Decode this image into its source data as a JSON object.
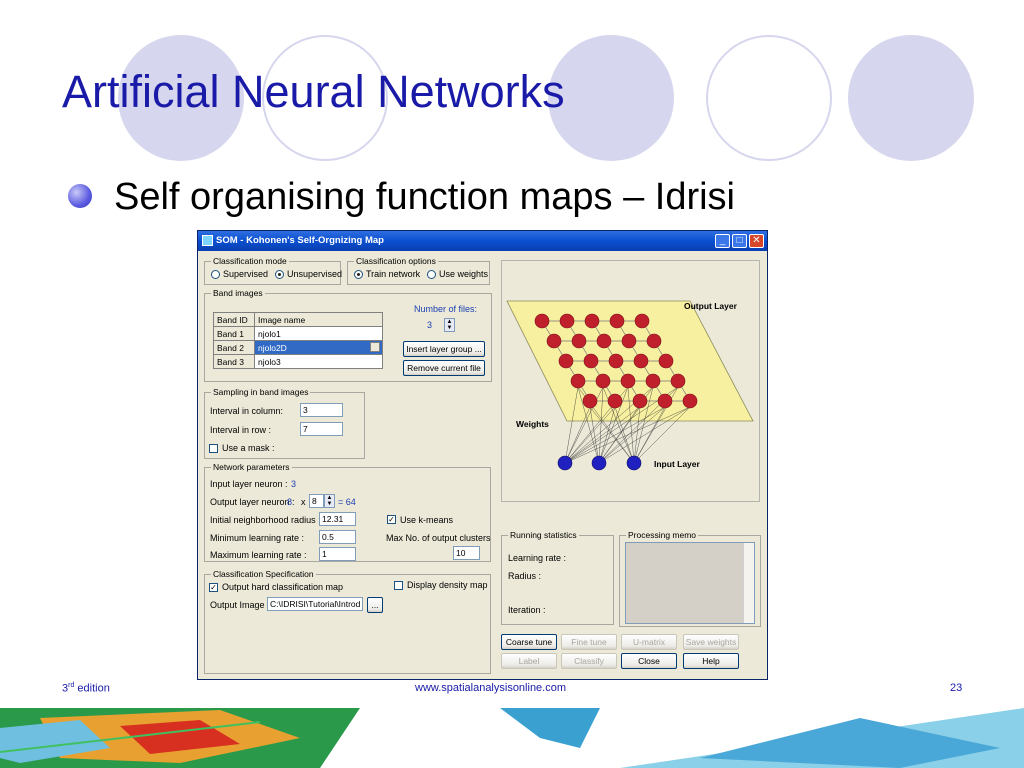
{
  "slide": {
    "title": "Artificial Neural Networks",
    "bullet": "Self organising function maps – Idrisi"
  },
  "window": {
    "title": "SOM - Kohonen's Self-Orgnizing Map",
    "classification_mode": {
      "label": "Classification mode",
      "options": [
        "Supervised",
        "Unsupervised"
      ],
      "selected": "Unsupervised"
    },
    "classification_options": {
      "label": "Classification options",
      "options": [
        "Train network",
        "Use weights"
      ],
      "selected": "Train network"
    },
    "band_images": {
      "label": "Band images",
      "headers": [
        "Band ID",
        "Image name"
      ],
      "rows": [
        {
          "id": "Band 1",
          "name": "njolo1"
        },
        {
          "id": "Band 2",
          "name": "njolo2D"
        },
        {
          "id": "Band 3",
          "name": "njolo3"
        }
      ],
      "selected_row": "Band 2",
      "number_of_files_label": "Number of files:",
      "number_of_files": "3",
      "insert_button": "Insert layer group ...",
      "remove_button": "Remove current file"
    },
    "sampling": {
      "label": "Sampling in band images",
      "interval_column_label": "Interval in column:",
      "interval_column": "3",
      "interval_row_label": "Interval in row :",
      "interval_row": "7",
      "use_mask_label": "Use a mask :",
      "use_mask": false
    },
    "network": {
      "label": "Network parameters",
      "input_neuron_label": "Input layer neuron :",
      "input_neuron": "3",
      "output_neuron_label": "Output layer neuron :",
      "output_a": "8",
      "times": "x",
      "output_b": "8",
      "equals": "= 64",
      "radius_label": "Initial neighborhood radius :",
      "radius": "12.31",
      "use_kmeans_label": "Use k-means",
      "use_kmeans": true,
      "min_rate_label": "Minimum learning rate :",
      "min_rate": "0.5",
      "max_clusters_label": "Max No. of output clusters",
      "max_clusters": "10",
      "max_rate_label": "Maximum learning rate :",
      "max_rate": "1"
    },
    "spec": {
      "label": "Classification Specification",
      "hard_map_label": "Output hard classification map",
      "hard_map": true,
      "density_label": "Display density map",
      "density": false,
      "output_image_label": "Output Image :",
      "output_image": "C:\\IDRISI\\Tutorial\\Introd",
      "browse": "..."
    },
    "diagram": {
      "output_layer": "Output Layer",
      "weights": "Weights",
      "input_layer": "Input Layer"
    },
    "running": {
      "label": "Running statistics",
      "learning_rate": "Learning rate :",
      "radius": "Radius :",
      "iteration": "Iteration :"
    },
    "memo": {
      "label": "Processing memo"
    },
    "buttons": {
      "coarse": "Coarse tune",
      "fine": "Fine tune",
      "umatrix": "U-matrix",
      "save": "Save weights",
      "label": "Label",
      "classify": "Classify",
      "close": "Close",
      "help": "Help"
    }
  },
  "footer": {
    "edition_num": "3",
    "edition_sup": "rd",
    "edition_word": " edition",
    "url": "www.spatialanalysisonline.com",
    "page": "23"
  },
  "colors": {
    "title": "#1a1aa8",
    "circle": "#d6d6ee",
    "neuron_output": "#c0202c",
    "neuron_input": "#2020c0",
    "grid_plane": "#f7f0a0"
  }
}
